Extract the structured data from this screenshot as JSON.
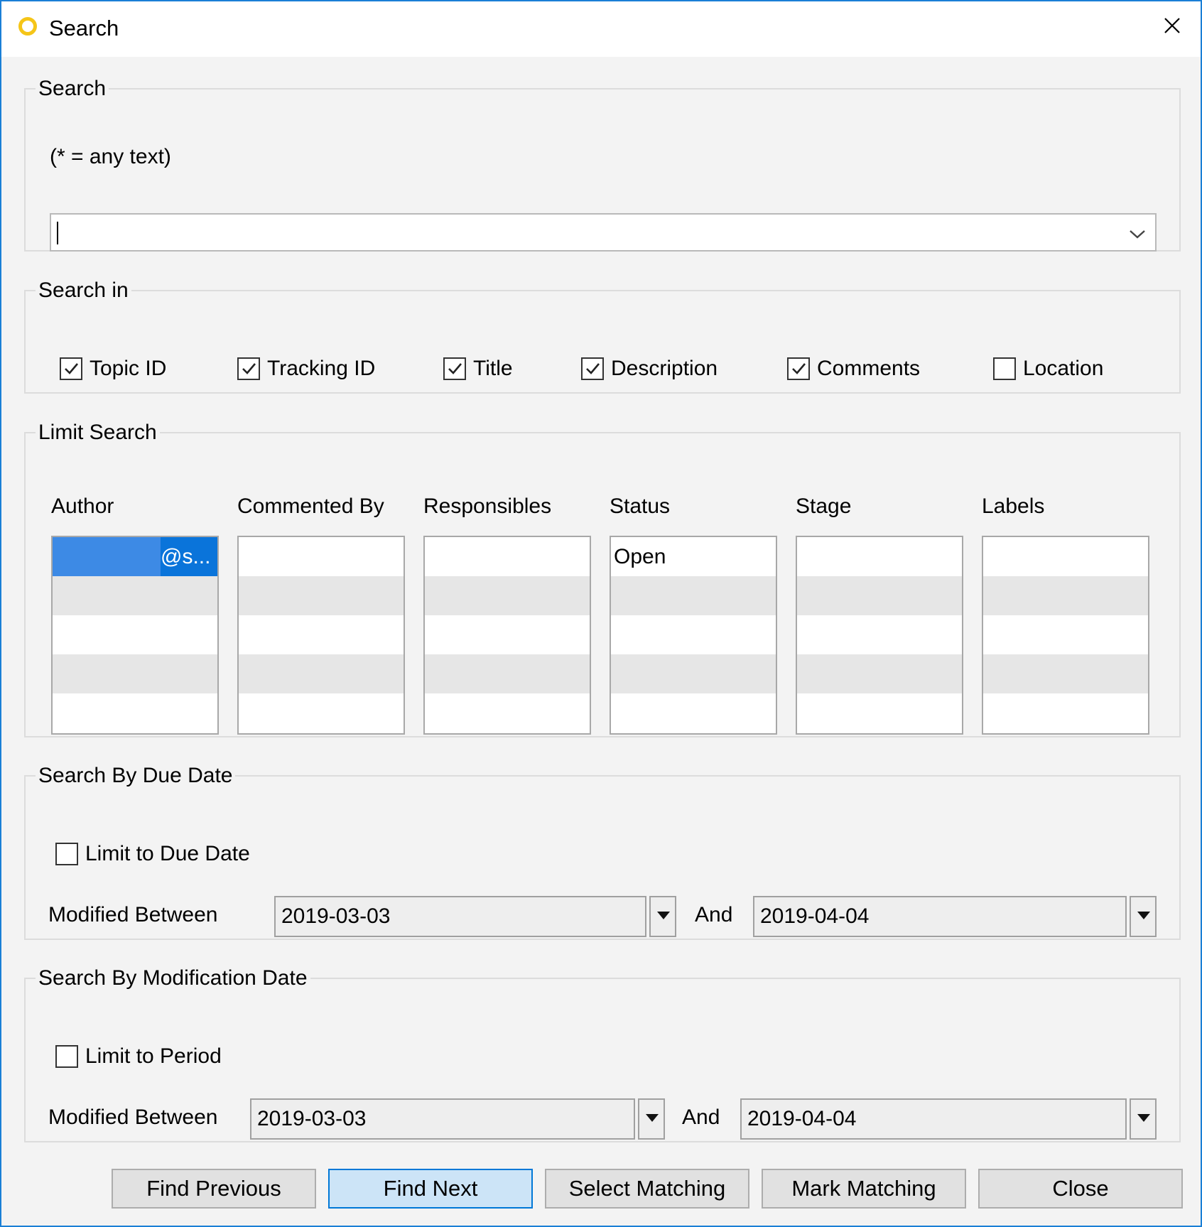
{
  "window": {
    "title": "Search"
  },
  "search": {
    "legend": "Search",
    "hint": "(* = any text)",
    "query_value": ""
  },
  "search_in": {
    "legend": "Search in",
    "options": [
      {
        "label": "Topic ID",
        "checked": true
      },
      {
        "label": "Tracking ID",
        "checked": true
      },
      {
        "label": "Title",
        "checked": true
      },
      {
        "label": "Description",
        "checked": true
      },
      {
        "label": "Comments",
        "checked": true
      },
      {
        "label": "Location",
        "checked": false
      }
    ]
  },
  "limit_search": {
    "legend": "Limit Search",
    "columns": [
      {
        "header": "Author",
        "items": [
          "@s..."
        ],
        "selected_index": 0
      },
      {
        "header": "Commented By",
        "items": []
      },
      {
        "header": "Responsibles",
        "items": []
      },
      {
        "header": "Status",
        "items": [
          "Open"
        ]
      },
      {
        "header": "Stage",
        "items": []
      },
      {
        "header": "Labels",
        "items": []
      }
    ]
  },
  "due_date": {
    "legend": "Search By Due Date",
    "limit_label": "Limit to Due Date",
    "limit_checked": false,
    "between_label": "Modified Between",
    "from": "2019-03-03",
    "and_label": "And",
    "to": "2019-04-04"
  },
  "mod_date": {
    "legend": "Search By Modification Date",
    "limit_label": "Limit to Period",
    "limit_checked": false,
    "between_label": "Modified Between",
    "from": "2019-03-03",
    "and_label": "And",
    "to": "2019-04-04"
  },
  "buttons": {
    "find_previous": "Find Previous",
    "find_next": "Find Next",
    "select_matching": "Select Matching",
    "mark_matching": "Mark Matching",
    "close": "Close"
  },
  "colors": {
    "accent": "#0078d7",
    "selection": "#0a74da",
    "icon": "#f5c518"
  }
}
